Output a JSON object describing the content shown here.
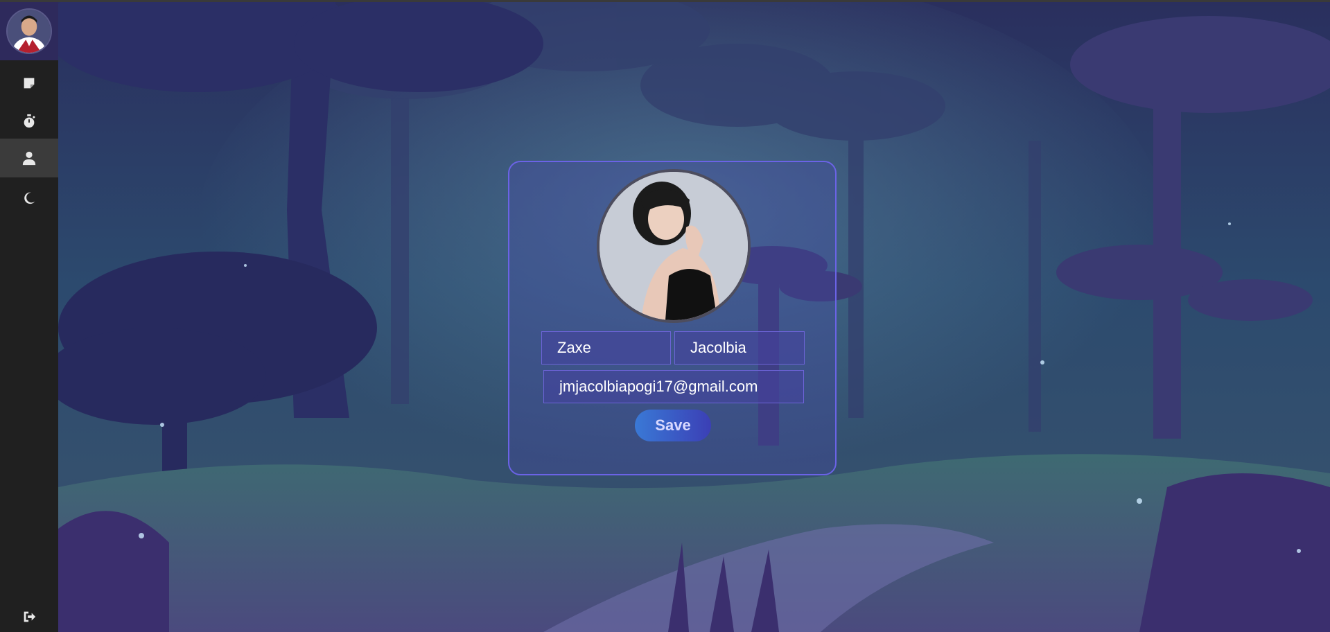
{
  "sidebar": {
    "avatar_icon": "user-avatar",
    "items": [
      {
        "name": "notes",
        "icon": "sticky-note-icon"
      },
      {
        "name": "timer",
        "icon": "stopwatch-icon"
      },
      {
        "name": "profile",
        "icon": "user-icon",
        "active": true
      },
      {
        "name": "theme",
        "icon": "moon-icon"
      }
    ],
    "logout_icon": "sign-out-icon"
  },
  "profile": {
    "first_name": "Zaxe",
    "last_name": "Jacolbia",
    "email": "jmjacolbiapogi17@gmail.com",
    "save_label": "Save"
  },
  "colors": {
    "accent": "#6b63e6",
    "button_start": "#3a79d6",
    "button_end": "#3b3fb5",
    "sidebar_bg": "#202020"
  }
}
